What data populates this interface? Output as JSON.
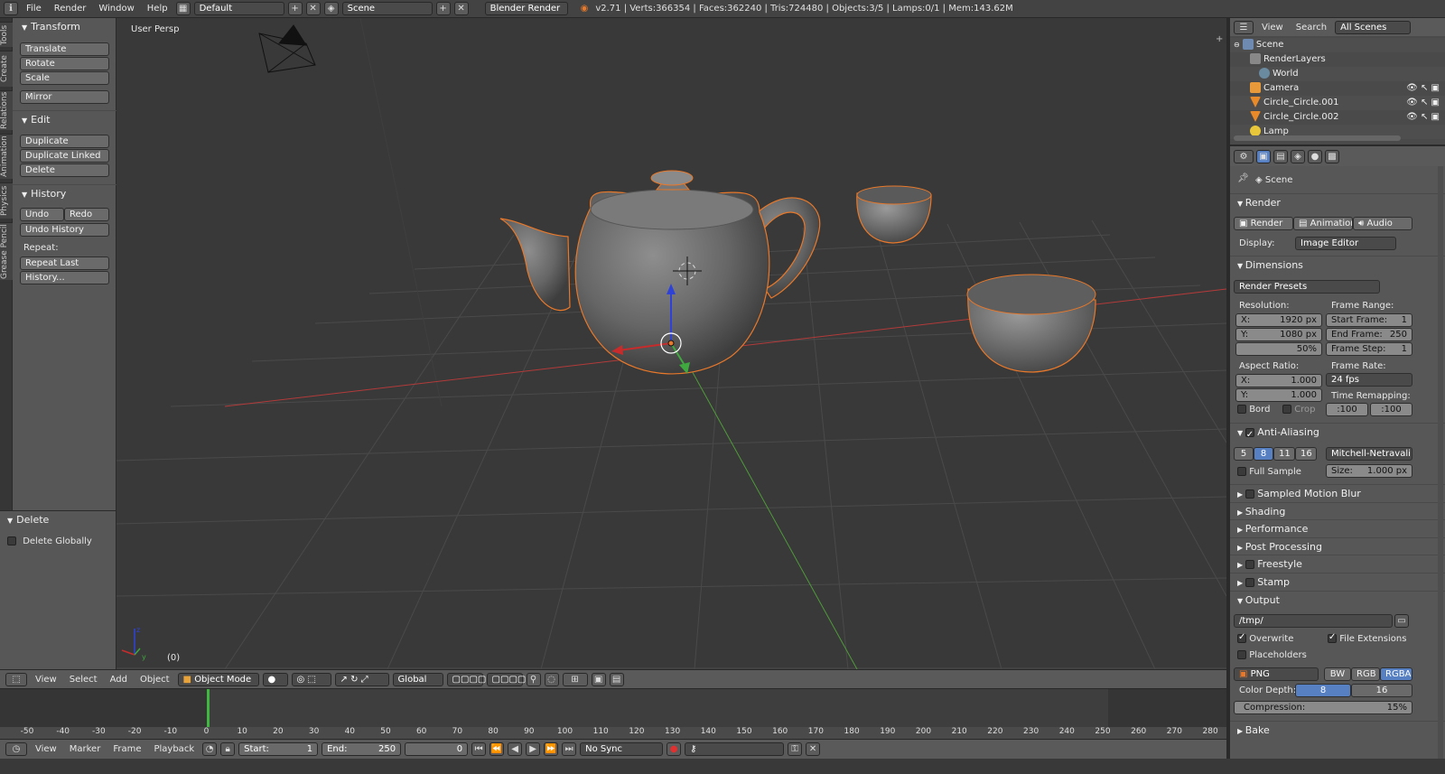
{
  "topbar": {
    "menus": [
      "File",
      "Render",
      "Window",
      "Help"
    ],
    "layout": "Default",
    "scene": "Scene",
    "engine": "Blender Render",
    "stats": "v2.71 | Verts:366354 | Faces:362240 | Tris:724480 | Objects:3/5 | Lamps:0/1 | Mem:143.62M"
  },
  "tooltabs": [
    "Tools",
    "Create",
    "Relations",
    "Animation",
    "Physics",
    "Grease Pencil"
  ],
  "toolshelf": {
    "transform": {
      "title": "Transform",
      "buttons": [
        "Translate",
        "Rotate",
        "Scale",
        "Mirror"
      ]
    },
    "edit": {
      "title": "Edit",
      "buttons": [
        "Duplicate",
        "Duplicate Linked",
        "Delete"
      ]
    },
    "history": {
      "title": "History",
      "undo": "Undo",
      "redo": "Redo",
      "undo_history": "Undo History",
      "repeat_label": "Repeat:",
      "repeat_last": "Repeat Last",
      "history": "History..."
    }
  },
  "operator": {
    "title": "Delete",
    "option": "Delete Globally"
  },
  "viewport": {
    "label": "User Persp",
    "frame": "(0)"
  },
  "vpheader": {
    "menus": [
      "View",
      "Select",
      "Add",
      "Object"
    ],
    "mode": "Object Mode",
    "orientation": "Global"
  },
  "timeline": {
    "ticks": [
      "-50",
      "-40",
      "-30",
      "-20",
      "-10",
      "0",
      "10",
      "20",
      "30",
      "40",
      "50",
      "60",
      "70",
      "80",
      "90",
      "100",
      "110",
      "120",
      "130",
      "140",
      "150",
      "160",
      "170",
      "180",
      "190",
      "200",
      "210",
      "220",
      "230",
      "240",
      "250",
      "260",
      "270",
      "280"
    ],
    "menus": [
      "View",
      "Marker",
      "Frame",
      "Playback"
    ],
    "start_label": "Start:",
    "start": "1",
    "end_label": "End:",
    "end": "250",
    "current": "0",
    "sync": "No Sync"
  },
  "outliner": {
    "menus": [
      "View",
      "Search"
    ],
    "filter": "All Scenes",
    "rows": [
      "Scene",
      "RenderLayers",
      "World",
      "Camera",
      "Circle_Circle.001",
      "Circle_Circle.002",
      "Lamp"
    ]
  },
  "properties": {
    "context": "Scene",
    "render": {
      "title": "Render",
      "render_btn": "Render",
      "animation_btn": "Animation",
      "audio_btn": "Audio",
      "display_label": "Display:",
      "display": "Image Editor"
    },
    "dimensions": {
      "title": "Dimensions",
      "presets": "Render Presets",
      "resolution_label": "Resolution:",
      "res_x_label": "X:",
      "res_x": "1920 px",
      "res_y_label": "Y:",
      "res_y": "1080 px",
      "res_pct": "50%",
      "frame_range_label": "Frame Range:",
      "start_label": "Start Frame:",
      "start": "1",
      "end_label": "End Frame:",
      "end": "250",
      "step_label": "Frame Step:",
      "step": "1",
      "aspect_label": "Aspect Ratio:",
      "asp_x_label": "X:",
      "asp_x": "1.000",
      "asp_y_label": "Y:",
      "asp_y": "1.000",
      "frame_rate_label": "Frame Rate:",
      "frame_rate": "24 fps",
      "remap_label": "Time Remapping:",
      "remap_old": ":100",
      "remap_new": ":100",
      "bord": "Bord",
      "crop": "Crop"
    },
    "aa": {
      "title": "Anti-Aliasing",
      "samples": [
        "5",
        "8",
        "11",
        "16"
      ],
      "filter": "Mitchell-Netravali",
      "full_sample": "Full Sample",
      "size_label": "Size:",
      "size": "1.000 px"
    },
    "collapsed": [
      "Sampled Motion Blur",
      "Shading",
      "Performance",
      "Post Processing",
      "Freestyle",
      "Stamp"
    ],
    "output": {
      "title": "Output",
      "path": "/tmp/",
      "overwrite": "Overwrite",
      "file_ext": "File Extensions",
      "placeholders": "Placeholders",
      "format": "PNG",
      "bw": "BW",
      "rgb": "RGB",
      "rgba": "RGBA",
      "depth_label": "Color Depth:",
      "depth_8": "8",
      "depth_16": "16",
      "compression_label": "Compression:",
      "compression": "15%"
    },
    "bake": "Bake"
  },
  "colors": {
    "accent": "#5680c2",
    "selection_outline": "#e8782a",
    "x_axis": "#b33a3a",
    "y_axis": "#4f9a3a"
  }
}
